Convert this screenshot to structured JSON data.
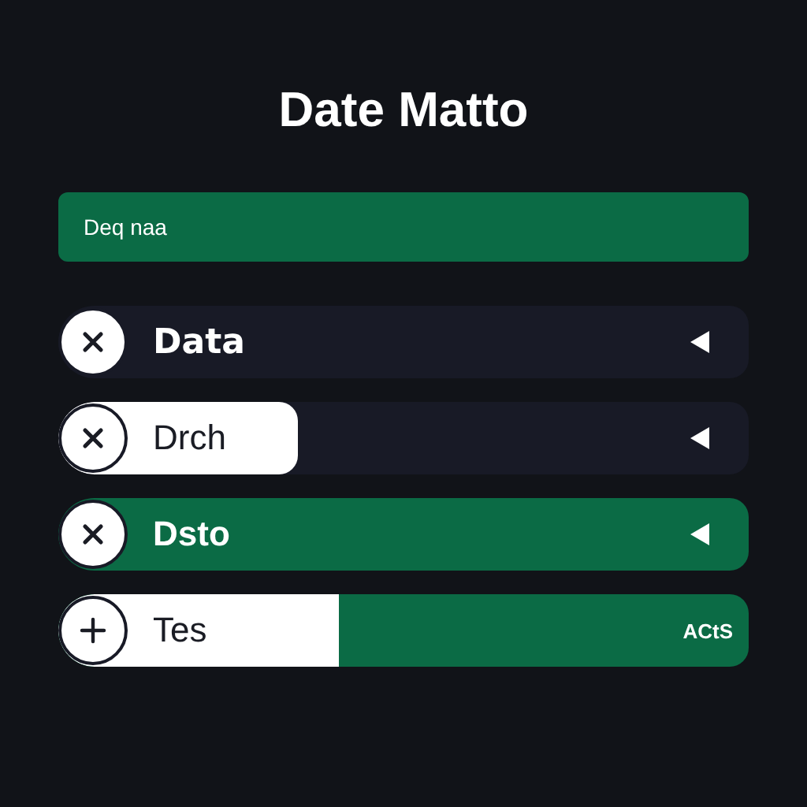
{
  "title": "Date Matto",
  "banner": {
    "text": "Deq naa"
  },
  "rows": [
    {
      "kind": "plain",
      "label": "Data"
    },
    {
      "kind": "pill",
      "label": "Drch",
      "level": 0.32
    },
    {
      "kind": "filled",
      "label": "Dsto"
    },
    {
      "kind": "split",
      "label": "Tes",
      "level": 0.38,
      "value": "ACtS"
    }
  ]
}
